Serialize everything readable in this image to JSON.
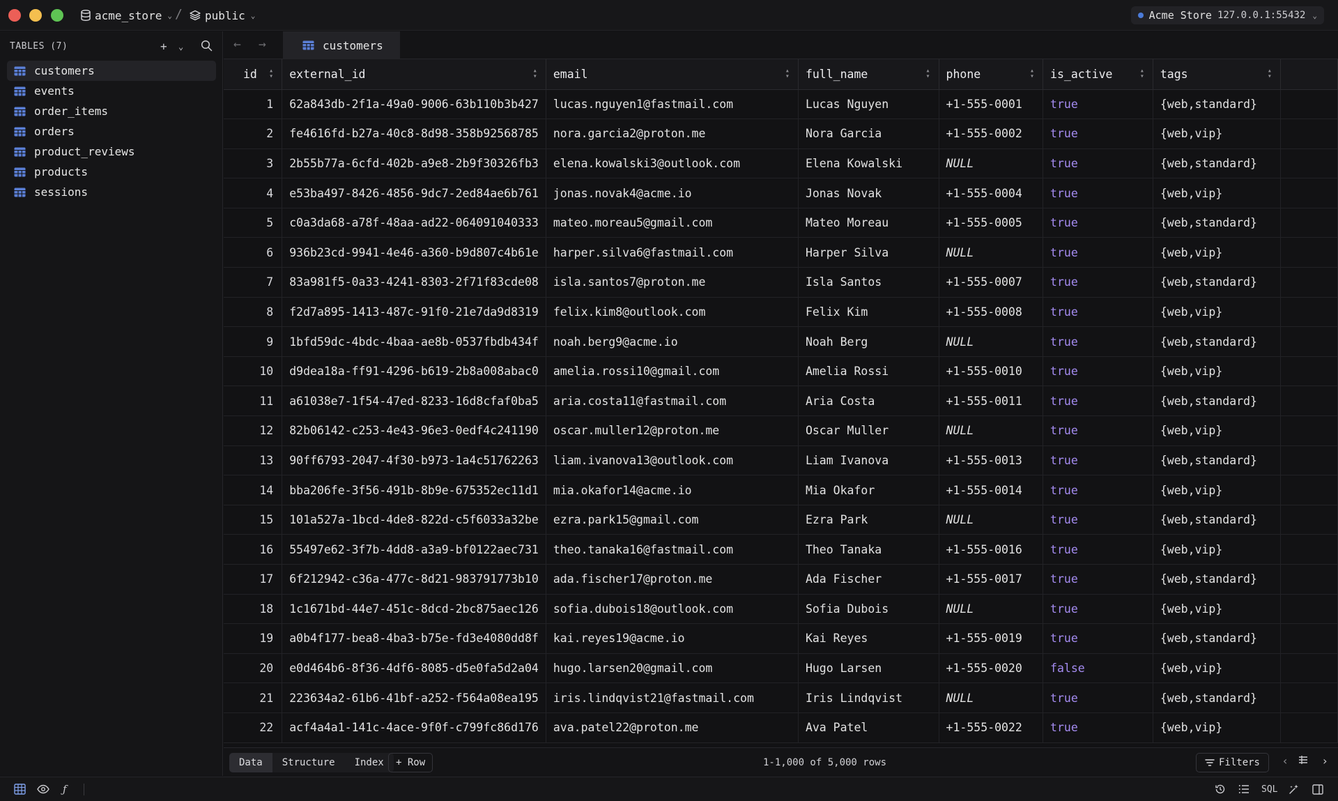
{
  "titlebar": {
    "database": "acme_store",
    "separator": "/",
    "schema": "public",
    "connection_name": "Acme Store",
    "connection_host": "127.0.0.1:55432"
  },
  "sidebar": {
    "header": "TABLES (7)",
    "items": [
      {
        "label": "customers",
        "active": true
      },
      {
        "label": "events"
      },
      {
        "label": "order_items"
      },
      {
        "label": "orders"
      },
      {
        "label": "product_reviews"
      },
      {
        "label": "products"
      },
      {
        "label": "sessions"
      }
    ]
  },
  "tabs": [
    {
      "label": "customers"
    }
  ],
  "grid": {
    "columns": [
      "id",
      "external_id",
      "email",
      "full_name",
      "phone",
      "is_active",
      "tags"
    ],
    "rows": [
      [
        "1",
        "62a843db-2f1a-49a0-9006-63b110b3b427",
        "lucas.nguyen1@fastmail.com",
        "Lucas Nguyen",
        "+1-555-0001",
        "true",
        "{web,standard}"
      ],
      [
        "2",
        "fe4616fd-b27a-40c8-8d98-358b92568785",
        "nora.garcia2@proton.me",
        "Nora Garcia",
        "+1-555-0002",
        "true",
        "{web,vip}"
      ],
      [
        "3",
        "2b55b77a-6cfd-402b-a9e8-2b9f30326fb3",
        "elena.kowalski3@outlook.com",
        "Elena Kowalski",
        "NULL",
        "true",
        "{web,standard}"
      ],
      [
        "4",
        "e53ba497-8426-4856-9dc7-2ed84ae6b761",
        "jonas.novak4@acme.io",
        "Jonas Novak",
        "+1-555-0004",
        "true",
        "{web,vip}"
      ],
      [
        "5",
        "c0a3da68-a78f-48aa-ad22-064091040333",
        "mateo.moreau5@gmail.com",
        "Mateo Moreau",
        "+1-555-0005",
        "true",
        "{web,standard}"
      ],
      [
        "6",
        "936b23cd-9941-4e46-a360-b9d807c4b61e",
        "harper.silva6@fastmail.com",
        "Harper Silva",
        "NULL",
        "true",
        "{web,vip}"
      ],
      [
        "7",
        "83a981f5-0a33-4241-8303-2f71f83cde08",
        "isla.santos7@proton.me",
        "Isla Santos",
        "+1-555-0007",
        "true",
        "{web,standard}"
      ],
      [
        "8",
        "f2d7a895-1413-487c-91f0-21e7da9d8319",
        "felix.kim8@outlook.com",
        "Felix Kim",
        "+1-555-0008",
        "true",
        "{web,vip}"
      ],
      [
        "9",
        "1bfd59dc-4bdc-4baa-ae8b-0537fbdb434f",
        "noah.berg9@acme.io",
        "Noah Berg",
        "NULL",
        "true",
        "{web,standard}"
      ],
      [
        "10",
        "d9dea18a-ff91-4296-b619-2b8a008abac0",
        "amelia.rossi10@gmail.com",
        "Amelia Rossi",
        "+1-555-0010",
        "true",
        "{web,vip}"
      ],
      [
        "11",
        "a61038e7-1f54-47ed-8233-16d8cfaf0ba5",
        "aria.costa11@fastmail.com",
        "Aria Costa",
        "+1-555-0011",
        "true",
        "{web,standard}"
      ],
      [
        "12",
        "82b06142-c253-4e43-96e3-0edf4c241190",
        "oscar.muller12@proton.me",
        "Oscar Muller",
        "NULL",
        "true",
        "{web,vip}"
      ],
      [
        "13",
        "90ff6793-2047-4f30-b973-1a4c51762263",
        "liam.ivanova13@outlook.com",
        "Liam Ivanova",
        "+1-555-0013",
        "true",
        "{web,standard}"
      ],
      [
        "14",
        "bba206fe-3f56-491b-8b9e-675352ec11d1",
        "mia.okafor14@acme.io",
        "Mia Okafor",
        "+1-555-0014",
        "true",
        "{web,vip}"
      ],
      [
        "15",
        "101a527a-1bcd-4de8-822d-c5f6033a32be",
        "ezra.park15@gmail.com",
        "Ezra Park",
        "NULL",
        "true",
        "{web,standard}"
      ],
      [
        "16",
        "55497e62-3f7b-4dd8-a3a9-bf0122aec731",
        "theo.tanaka16@fastmail.com",
        "Theo Tanaka",
        "+1-555-0016",
        "true",
        "{web,vip}"
      ],
      [
        "17",
        "6f212942-c36a-477c-8d21-983791773b10",
        "ada.fischer17@proton.me",
        "Ada Fischer",
        "+1-555-0017",
        "true",
        "{web,standard}"
      ],
      [
        "18",
        "1c1671bd-44e7-451c-8dcd-2bc875aec126",
        "sofia.dubois18@outlook.com",
        "Sofia Dubois",
        "NULL",
        "true",
        "{web,vip}"
      ],
      [
        "19",
        "a0b4f177-bea8-4ba3-b75e-fd3e4080dd8f",
        "kai.reyes19@acme.io",
        "Kai Reyes",
        "+1-555-0019",
        "true",
        "{web,standard}"
      ],
      [
        "20",
        "e0d464b6-8f36-4df6-8085-d5e0fa5d2a04",
        "hugo.larsen20@gmail.com",
        "Hugo Larsen",
        "+1-555-0020",
        "false",
        "{web,vip}"
      ],
      [
        "21",
        "223634a2-61b6-41bf-a252-f564a08ea195",
        "iris.lindqvist21@fastmail.com",
        "Iris Lindqvist",
        "NULL",
        "true",
        "{web,standard}"
      ],
      [
        "22",
        "acf4a4a1-141c-4ace-9f0f-c799fc86d176",
        "ava.patel22@proton.me",
        "Ava Patel",
        "+1-555-0022",
        "true",
        "{web,vip}"
      ]
    ]
  },
  "footer": {
    "views": [
      "Data",
      "Structure",
      "Index"
    ],
    "active_view": "Data",
    "add_row": "+ Row",
    "row_count": "1-1,000 of 5,000 rows",
    "filters": "Filters"
  },
  "statusbar": {
    "sql_label": "SQL"
  },
  "colors": {
    "boolean": "#a48bf0",
    "table_icon": "#5b7fd6",
    "connection_dot": "#4b7bd8"
  }
}
